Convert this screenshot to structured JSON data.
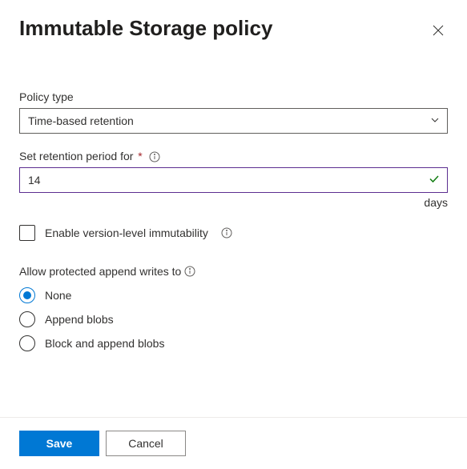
{
  "header": {
    "title": "Immutable Storage policy"
  },
  "policy_type": {
    "label": "Policy type",
    "value": "Time-based retention"
  },
  "retention": {
    "label": "Set retention period for",
    "value": "14",
    "unit": "days"
  },
  "version_immutability": {
    "label": "Enable version-level immutability"
  },
  "append_writes": {
    "label": "Allow protected append writes to",
    "options": {
      "none": "None",
      "append": "Append blobs",
      "block_append": "Block and append blobs"
    }
  },
  "footer": {
    "save": "Save",
    "cancel": "Cancel"
  }
}
